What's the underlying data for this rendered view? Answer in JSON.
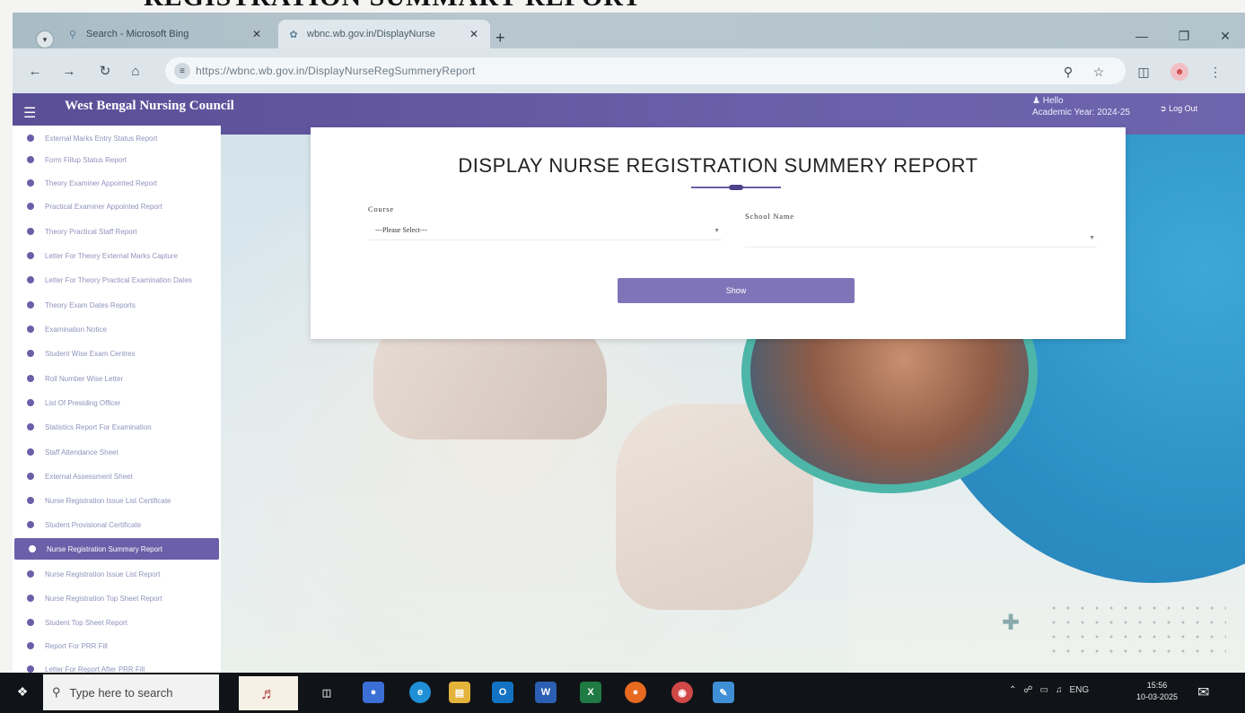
{
  "doc_heading": "REGISTRATION SUMMARY REPORT",
  "browser": {
    "tabs": [
      {
        "label": "Search - Microsoft Bing",
        "icon": "search-icon"
      },
      {
        "label": "wbnc.wb.gov.in/DisplayNurse",
        "icon": "site-favicon"
      }
    ],
    "url": "https://wbnc.wb.gov.in/DisplayNurseRegSummeryReport"
  },
  "app": {
    "title": "West Bengal Nursing Council",
    "hello": "Hello",
    "academic_year": "Academic Year: 2024-25",
    "logout": "Log Out"
  },
  "sidebar": {
    "items": [
      {
        "label": "External Marks Entry Status Report"
      },
      {
        "label": "Form Fillup Status Report"
      },
      {
        "label": "Theory Examiner Appointed Report"
      },
      {
        "label": "Practical Examiner Appointed Report"
      },
      {
        "label": "Theory Practical Staff Report"
      },
      {
        "label": "Letter For Theory External Marks Capture"
      },
      {
        "label": "Letter For Theory Practical Examination Dates"
      },
      {
        "label": "Theory Exam Dates Reports"
      },
      {
        "label": "Examination Notice"
      },
      {
        "label": "Student Wise Exam Centres"
      },
      {
        "label": "Roll Number Wise Letter"
      },
      {
        "label": "List Of Presiding Officer"
      },
      {
        "label": "Statistics Report For Examination"
      },
      {
        "label": "Staff Attendance Sheet"
      },
      {
        "label": "External Assessment Sheet"
      },
      {
        "label": "Nurse Registration Issue List Certificate"
      },
      {
        "label": "Student Provisional Certificate"
      },
      {
        "label": "Nurse Registration Summary Report",
        "active": true
      },
      {
        "label": "Nurse Registration Issue List Report"
      },
      {
        "label": "Nurse Registration Top Sheet Report"
      },
      {
        "label": "Student Top Sheet Report"
      },
      {
        "label": "Report For PRR Fill"
      },
      {
        "label": "Letter For Report After PRR Fill"
      }
    ]
  },
  "form": {
    "title": "DISPLAY NURSE REGISTRATION SUMMERY REPORT",
    "course_label": "Course",
    "course_value": "---Please Select---",
    "school_label": "School Name",
    "school_value": "",
    "show_button": "Show"
  },
  "taskbar": {
    "search_placeholder": "Type here to search",
    "language": "ENG",
    "time": "15:56",
    "date": "10-03-2025"
  },
  "colors": {
    "accent": "#6a5fa8",
    "sidebar_text": "#8f93bd",
    "button": "#8074b8"
  }
}
